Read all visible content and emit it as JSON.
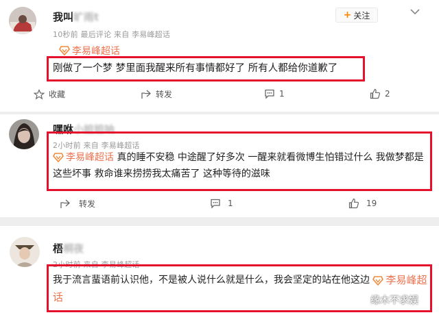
{
  "colors": {
    "highlight_box": "#e5102c",
    "topic_orange": "#eb7350",
    "follow_plus": "#ff8200",
    "meta_gray": "#999999"
  },
  "posts": [
    {
      "user_name": "我叫",
      "user_name_obscured": "旷雨t",
      "meta": "10秒前 最后评论 来自 李易峰超话",
      "topic": "李易峰超话",
      "text": "刚做了一个梦 梦里面我醒来所有事情都好了 所有人都给你道歉了",
      "follow_label": "关注",
      "actions": {
        "favorite": "收藏",
        "repost": "转发",
        "comment": "1",
        "like": "2"
      }
    },
    {
      "user_name": "嘿咻",
      "user_name_obscured": "小姐姐呐",
      "meta": "2小时前 来自 李易峰超话",
      "topic": "李易峰超话",
      "text": "真的睡不安稳  中途醒了好多次 一醒来就看微博生怕错过什么 我做梦都是这些坏事  救命谁来捞捞我太痛苦了 这种等待的滋味",
      "actions": {
        "repost": "转发",
        "comment": "1",
        "like": "19"
      }
    },
    {
      "user_name": "梧",
      "user_name_obscured": "桐夜",
      "meta": "2小时前 来自 李易峰超话",
      "topic": "李易峰超话",
      "text_main": "我于流言蜚语前认识他，不是被人说什么就是什么，我会坚定的站在他这边",
      "topic_tail": "李易峰超",
      "text_tail": "话"
    }
  ],
  "watermark": "缘木不求娱"
}
